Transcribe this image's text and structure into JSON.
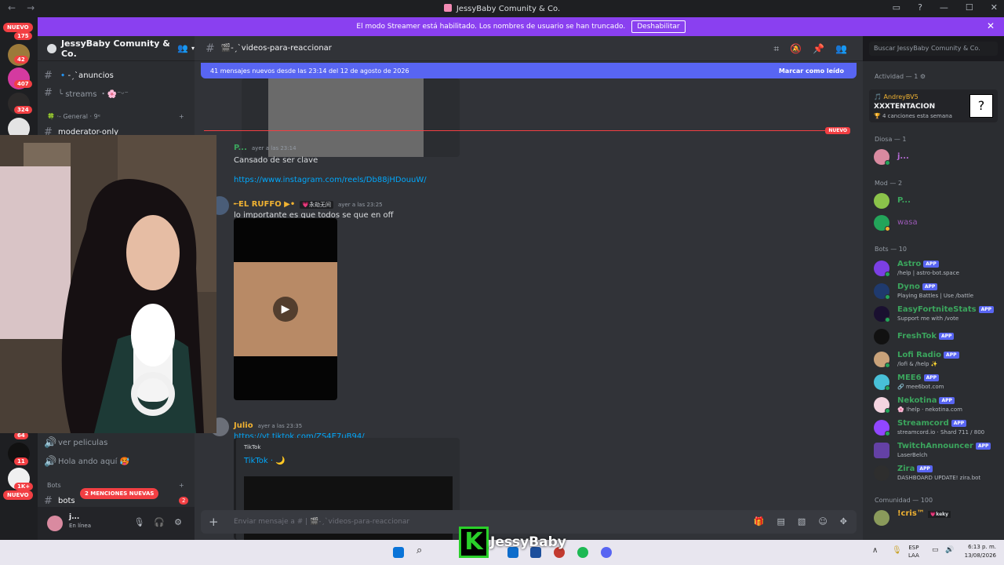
{
  "window": {
    "title": "JessyBaby Comunity & Co."
  },
  "banner": {
    "text": "El modo Streamer está habilitado. Los nombres de usuario se han truncado.",
    "button": "Deshabilitar"
  },
  "guilds": {
    "badges": [
      "175",
      "42",
      "407",
      "324",
      "64",
      "11",
      "1K+"
    ],
    "nuevo": "NUEVO",
    "mention_badge": "2"
  },
  "server": {
    "name": "JessyBaby Comunity & Co."
  },
  "channels": [
    {
      "name": "🔹-ˏˋanuncios"
    },
    {
      "name": "╰ streams ・🌸⁻ᵕ⁻"
    },
    {
      "name": "moderator-only"
    },
    {
      "name": "ver peliculas"
    },
    {
      "name": "Hola ando aquí 🥵"
    },
    {
      "name": "bots"
    }
  ],
  "categories": {
    "general": "🍀 ·- General · 9ᵉ",
    "bots": "Bots"
  },
  "mention_pill": "2 MENCIONES NUEVAS",
  "user_panel": {
    "name": "j...",
    "status": "En línea"
  },
  "channel_header": {
    "name": "🎬-ˏˋvideos-para-reaccionar",
    "search_placeholder": "Buscar JessyBaby Comunity & Co."
  },
  "new_messages_bar": {
    "text": "41 mensajes nuevos desde las 23:14 del 12 de agosto de 2026",
    "action": "Marcar como leído"
  },
  "divider_label": "NUEVO",
  "messages": [
    {
      "author": "P...",
      "time": "ayer a las 23:14",
      "text": "Cansado de ser clave",
      "link": "https://www.instagram.com/reels/Db88jHDouuW/",
      "color": "#3ba55d"
    },
    {
      "author": "╾EL RUFFO ▶•",
      "tag": "💗永劫无间",
      "time": "ayer a las 23:25",
      "text": "lo importante es que todos se que en off",
      "color": "#f0b232"
    },
    {
      "author": "Julio",
      "time": "ayer a las 23:35",
      "link": "https://vt.tiktok.com/ZS4E7uB94/",
      "color": "#f0b232",
      "embed": {
        "provider": "TikTok",
        "title": "TikTok · 🌙"
      }
    }
  ],
  "composer": {
    "placeholder": "Enviar mensaje a # | 🎬-ˏˋvideos-para-reaccionar"
  },
  "members": {
    "activity_header": "Actividad — 1 ⚙",
    "activity": {
      "name": "AndreyBV5",
      "song": "XXXTENTACION",
      "detail": "🏆 4 canciones esta semana"
    },
    "diosa_header": "Diosa — 1",
    "diosa": [
      {
        "name": "j...",
        "color": "#b86cd8"
      }
    ],
    "mod_header": "Mod — 2",
    "mods": [
      {
        "name": "P...",
        "color": "#3ba55d"
      },
      {
        "name": "wasa",
        "color": "#9b59b6"
      }
    ],
    "bots_header": "Bots — 10",
    "bots": [
      {
        "name": "Astro",
        "status": "/help | astro-bot.space",
        "color": "#3ba55d"
      },
      {
        "name": "Dyno",
        "status": "Playing Battles | Use /battle",
        "color": "#3ba55d"
      },
      {
        "name": "EasyFortniteStats",
        "status": "Support me with /vote",
        "color": "#3ba55d"
      },
      {
        "name": "FreshTok",
        "status": "",
        "color": "#3ba55d"
      },
      {
        "name": "Lofi Radio",
        "status": "/lofi & /help ✨",
        "color": "#3ba55d"
      },
      {
        "name": "MEE6",
        "status": "🔗 mee6bot.com",
        "color": "#3ba55d"
      },
      {
        "name": "Nekotina",
        "status": "🌸 !help · nekotina.com",
        "color": "#3ba55d"
      },
      {
        "name": "Streamcord",
        "status": "streamcord.io · Shard 711 / 800",
        "color": "#3ba55d"
      },
      {
        "name": "TwitchAnnouncer",
        "status": "LaserBelch",
        "color": "#3ba55d"
      },
      {
        "name": "Zira",
        "status": "DASHBOARD UPDATE! zira.bot",
        "color": "#3ba55d"
      }
    ],
    "app_label": "APP",
    "community_header": "Comunidad — 100",
    "community": [
      {
        "name": "!cris™",
        "tag": "💗keky",
        "color": "#f0b232"
      }
    ]
  },
  "watermark": "JessyBaby",
  "taskbar": {
    "lang": "ESP",
    "lang2": "LAA",
    "time": "6:13 p. m.",
    "date": "13/08/2026"
  }
}
